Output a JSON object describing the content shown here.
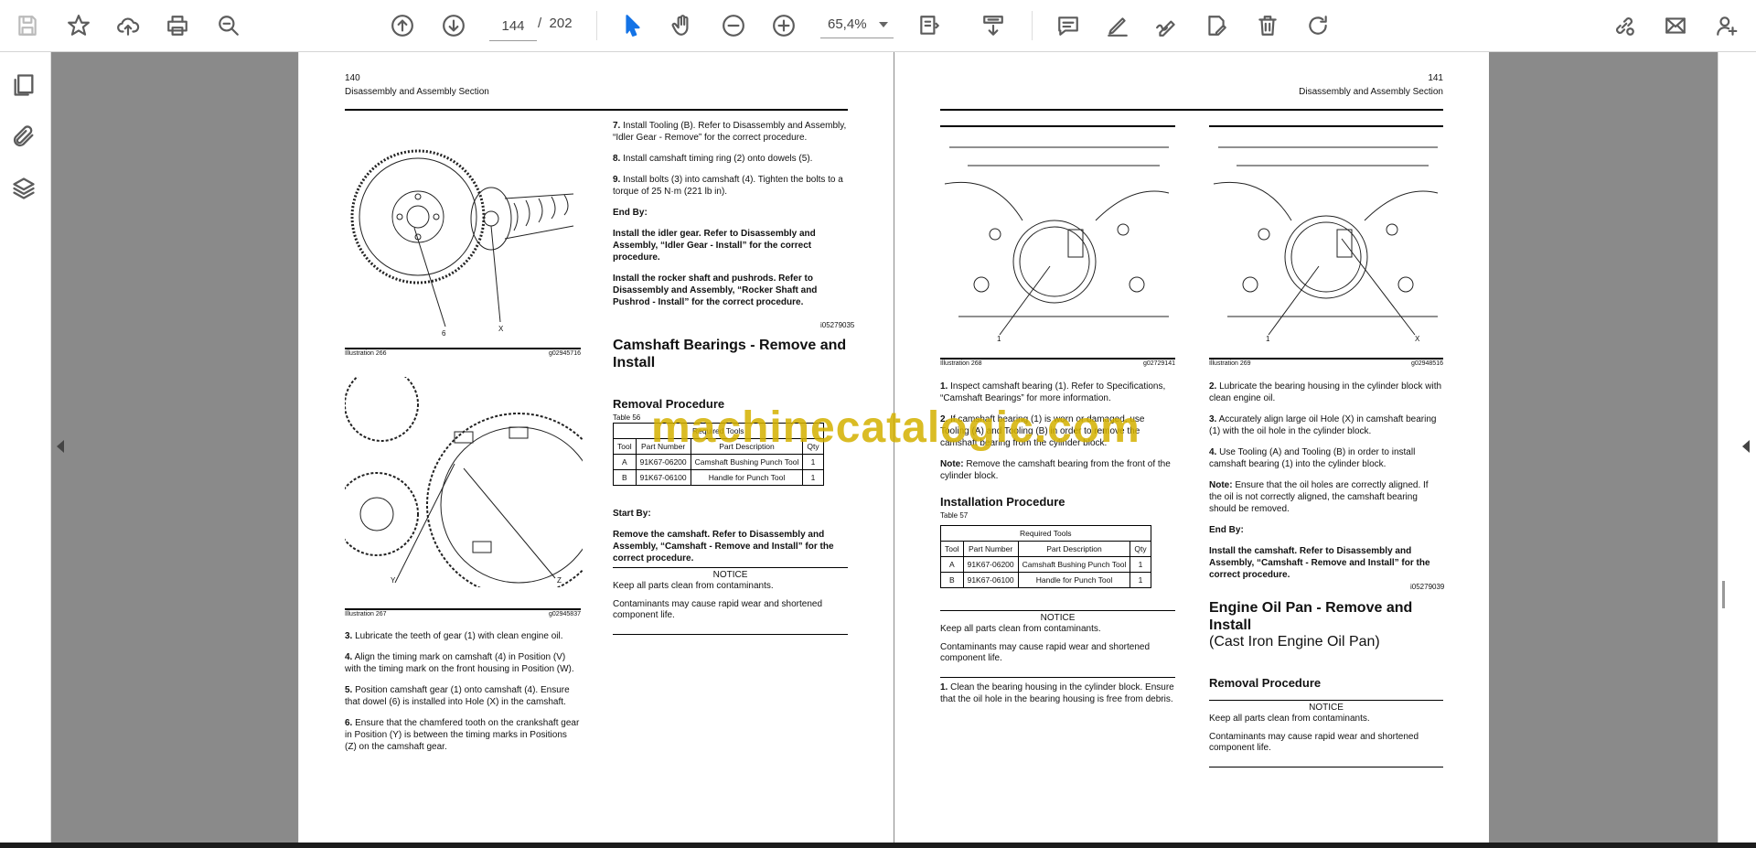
{
  "toolbar": {
    "current_page": "144",
    "page_separator": "/",
    "total_pages": "202",
    "zoom": "65,4%"
  },
  "left_page": {
    "page_number": "140",
    "section": "Disassembly and Assembly Section",
    "illus1_caption": "Illustration 266",
    "illus1_code": "g02945716",
    "illus1_label_6": "6",
    "illus1_label_x": "X",
    "illus2_caption": "Illustration 267",
    "illus2_code": "g02945837",
    "illus2_label_y": "Y",
    "illus2_label_z": "Z",
    "steps_left": [
      {
        "n": "3.",
        "t": "Lubricate the teeth of gear (1) with clean engine oil."
      },
      {
        "n": "4.",
        "t": "Align the timing mark on camshaft (4) in Position (V) with the timing mark on the front housing in Position (W)."
      },
      {
        "n": "5.",
        "t": "Position camshaft gear (1) onto camshaft (4). Ensure that dowel (6) is installed into Hole (X) in the camshaft."
      },
      {
        "n": "6.",
        "t": "Ensure that the chamfered tooth on the crankshaft gear in Position (Y) is between the timing marks in Positions (Z) on the camshaft gear."
      }
    ],
    "steps_right": [
      {
        "n": "7.",
        "t": "Install Tooling (B). Refer to Disassembly and Assembly, “Idler Gear - Remove” for the correct procedure."
      },
      {
        "n": "8.",
        "t": "Install camshaft timing ring (2) onto dowels (5)."
      },
      {
        "n": "9.",
        "t": "Install bolts (3) into camshaft (4). Tighten the bolts to a torque of 25 N·m (221 lb in)."
      }
    ],
    "end_by_label": "End By:",
    "end_by_items": [
      "Install the idler gear. Refer to Disassembly and Assembly, “Idler Gear - Install” for the correct procedure.",
      "Install the rocker shaft and pushrods. Refer to Disassembly and Assembly, “Rocker Shaft and Pushrod - Install” for the correct procedure."
    ],
    "ref_code": "i05279035",
    "section_title": "Camshaft Bearings - Remove and Install",
    "subsection": "Removal Procedure",
    "table_label": "Table 56",
    "table_title": "Required Tools",
    "table_headers": [
      "Tool",
      "Part Number",
      "Part Description",
      "Qty"
    ],
    "table_rows": [
      [
        "A",
        "91K67-06200",
        "Camshaft Bushing Punch Tool",
        "1"
      ],
      [
        "B",
        "91K67-06100",
        "Handle for Punch Tool",
        "1"
      ]
    ],
    "start_by_label": "Start By:",
    "start_by_text": "Remove the camshaft. Refer to Disassembly and Assembly, “Camshaft - Remove and Install” for the correct procedure.",
    "notice_title": "NOTICE",
    "notice_p1": "Keep all parts clean from contaminants.",
    "notice_p2": "Contaminants may cause rapid wear and shortened component life."
  },
  "right_page": {
    "page_number": "141",
    "section": "Disassembly and Assembly Section",
    "illus1_caption": "Illustration 268",
    "illus1_code": "g02729141",
    "illus1_label_1": "1",
    "illus2_caption": "Illustration 269",
    "illus2_code": "g02948516",
    "illus2_label_1": "1",
    "illus2_label_x": "X",
    "steps_a": [
      {
        "n": "1.",
        "t": "Inspect camshaft bearing (1). Refer to Specifications, “Camshaft Bearings” for more information."
      },
      {
        "n": "2.",
        "t": "If camshaft bearing (1) is worn or damaged, use Tooling (A) and Tooling (B) in order to remove the camshaft bearing from the cylinder block."
      }
    ],
    "note1_label": "Note:",
    "note1_text": "Remove the camshaft bearing from the front of the cylinder block.",
    "install_title": "Installation Procedure",
    "table_label": "Table 57",
    "table_title": "Required Tools",
    "table_headers": [
      "Tool",
      "Part Number",
      "Part Description",
      "Qty"
    ],
    "table_rows": [
      [
        "A",
        "91K67-06200",
        "Camshaft Bushing Punch Tool",
        "1"
      ],
      [
        "B",
        "91K67-06100",
        "Handle for Punch Tool",
        "1"
      ]
    ],
    "notice_title": "NOTICE",
    "notice_p1": "Keep all parts clean from contaminants.",
    "notice_p2": "Contaminants may cause rapid wear and shortened component life.",
    "step_b1": {
      "n": "1.",
      "t": "Clean the bearing housing in the cylinder block. Ensure that the oil hole in the bearing housing is free from debris."
    },
    "steps_c": [
      {
        "n": "2.",
        "t": "Lubricate the bearing housing in the cylinder block with clean engine oil."
      },
      {
        "n": "3.",
        "t": "Accurately align large oil Hole (X) in camshaft bearing (1) with the oil hole in the cylinder block."
      },
      {
        "n": "4.",
        "t": "Use Tooling (A) and Tooling (B) in order to install camshaft bearing (1) into the cylinder block."
      }
    ],
    "note2_label": "Note:",
    "note2_text": "Ensure that the oil holes are correctly aligned. If the oil is not correctly aligned, the camshaft bearing should be removed.",
    "end_by_label": "End By:",
    "end_by_text": "Install the camshaft. Refer to Disassembly and Assembly, “Camshaft - Remove and Install” for the correct procedure.",
    "ref_code": "i05279039",
    "section_title": "Engine Oil Pan - Remove and Install",
    "section_sub": "(Cast Iron Engine Oil Pan)",
    "subsection": "Removal Procedure",
    "notice2_title": "NOTICE",
    "notice2_p1": "Keep all parts clean from contaminants.",
    "notice2_p2": "Contaminants may cause rapid wear and shortened component life."
  },
  "watermark": "machinecatalogic.com",
  "colors": {
    "accent": "#1473e6",
    "gutter": "#8a8a8a",
    "watermark": "#d4b100"
  }
}
